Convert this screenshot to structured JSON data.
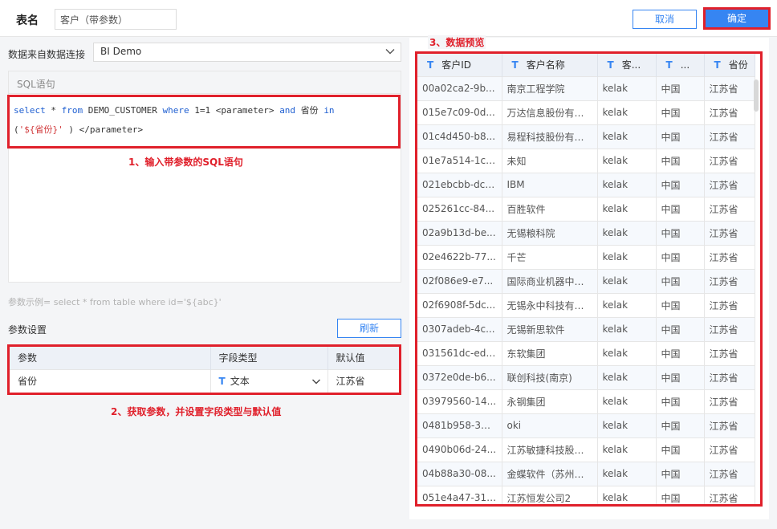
{
  "header": {
    "table_name_label": "表名",
    "table_name_value": "客户（带参数）",
    "cancel_label": "取消",
    "confirm_label": "确定"
  },
  "connection": {
    "label": "数据来自数据连接",
    "value": "BI Demo"
  },
  "sql": {
    "section_label": "SQL语句",
    "line1": {
      "select": "select",
      "star": " * ",
      "from": "from",
      "table": " DEMO_CUSTOMER ",
      "where": "where",
      "cond": " 1=1 <parameter> ",
      "and": "and",
      "field": " 省份 ",
      "in": "in"
    },
    "line2": {
      "open": "(",
      "value": "'${省份}'",
      "close": " ) </parameter>"
    }
  },
  "annotations": {
    "step1": "1、输入带参数的SQL语句",
    "step2": "2、获取参数，并设置字段类型与默认值",
    "step3": "3、数据预览"
  },
  "param_example": "参数示例= select * from table where id='${abc}'",
  "params": {
    "section_label": "参数设置",
    "refresh_label": "刷新",
    "headers": [
      "参数",
      "字段类型",
      "默认值"
    ],
    "rows": [
      {
        "name": "省份",
        "type_icon": "T",
        "type": "文本",
        "default": "江苏省"
      }
    ]
  },
  "preview": {
    "headers": [
      "客户ID",
      "客户名称",
      "客...",
      "...",
      "省份"
    ],
    "type_icon": "T",
    "rows": [
      [
        "00a02ca2-9b...",
        "南京工程学院",
        "kelak",
        "中国",
        "江苏省"
      ],
      [
        "015e7c09-0d...",
        "万达信息股份有限...",
        "kelak",
        "中国",
        "江苏省"
      ],
      [
        "01c4d450-b8...",
        "易程科技股份有限...",
        "kelak",
        "中国",
        "江苏省"
      ],
      [
        "01e7a514-1c4...",
        "未知",
        "kelak",
        "中国",
        "江苏省"
      ],
      [
        "021ebcbb-dc3...",
        "IBM",
        "kelak",
        "中国",
        "江苏省"
      ],
      [
        "025261cc-84...",
        "百胜软件",
        "kelak",
        "中国",
        "江苏省"
      ],
      [
        "02a9b13d-be...",
        "无锡粮科院",
        "kelak",
        "中国",
        "江苏省"
      ],
      [
        "02e4622b-77...",
        "千芒",
        "kelak",
        "中国",
        "江苏省"
      ],
      [
        "02f086e9-e7...",
        "国际商业机器中国...",
        "kelak",
        "中国",
        "江苏省"
      ],
      [
        "02f6908f-5dc...",
        "无锡永中科技有限...",
        "kelak",
        "中国",
        "江苏省"
      ],
      [
        "0307adeb-4c...",
        "无锡新思软件",
        "kelak",
        "中国",
        "江苏省"
      ],
      [
        "031561dc-ed2...",
        "东软集团",
        "kelak",
        "中国",
        "江苏省"
      ],
      [
        "0372e0de-b6...",
        "联创科技(南京)",
        "kelak",
        "中国",
        "江苏省"
      ],
      [
        "03979560-14...",
        "永钢集团",
        "kelak",
        "中国",
        "江苏省"
      ],
      [
        "0481b958-371...",
        "oki",
        "kelak",
        "中国",
        "江苏省"
      ],
      [
        "0490b06d-24...",
        "江苏敏捷科技股份...",
        "kelak",
        "中国",
        "江苏省"
      ],
      [
        "04b88a30-08...",
        "金蝶软件（苏州）...",
        "kelak",
        "中国",
        "江苏省"
      ],
      [
        "051e4a47-31b...",
        "江苏恒发公司2",
        "kelak",
        "中国",
        "江苏省"
      ]
    ]
  }
}
